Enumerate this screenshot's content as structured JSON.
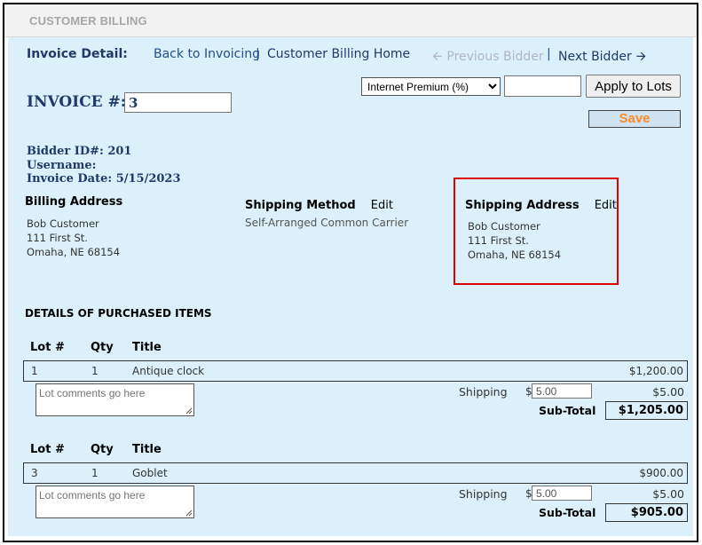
{
  "app": {
    "title": "CUSTOMER BILLING"
  },
  "nav": {
    "section_label": "Invoice Detail:",
    "back_link": "Back to Invoicing",
    "sep1": "|",
    "home_link": "Customer Billing Home",
    "prev_label": "Previous Bidder",
    "sep2": "|",
    "next_label": "Next Bidder"
  },
  "controls": {
    "premium_select": "Internet Premium (%)",
    "premium_value": "",
    "apply_label": "Apply to Lots",
    "save_label": "Save"
  },
  "invoice": {
    "number_label": "INVOICE #:",
    "number": "3",
    "bidder_id": "Bidder ID#: 201",
    "username": "Username:",
    "invoice_date": "Invoice Date: 5/15/2023"
  },
  "billing_address": {
    "heading": "Billing Address",
    "name": "Bob Customer",
    "street": "111 First St.",
    "city": "Omaha, NE 68154"
  },
  "shipping_method": {
    "heading": "Shipping Method",
    "edit_label": "Edit",
    "value": "Self-Arranged Common Carrier"
  },
  "shipping_address": {
    "heading": "Shipping Address",
    "edit_label": "Edit",
    "name": "Bob Customer",
    "street": "111 First St.",
    "city": "Omaha, NE 68154"
  },
  "details_heading": "DETAILS OF PURCHASED ITEMS",
  "items": [
    {
      "col_lot": "Lot #",
      "col_qty": "Qty",
      "col_title": "Title",
      "lot": "1",
      "qty": "1",
      "title": "Antique clock",
      "price": "$1,200.00",
      "comment_placeholder": "Lot comments go here",
      "shipping_label": "Shipping",
      "currency": "$",
      "shipping_input": "5.00",
      "shipping_amount": "$5.00",
      "subtotal_label": "Sub-Total",
      "subtotal": "$1,205.00"
    },
    {
      "col_lot": "Lot #",
      "col_qty": "Qty",
      "col_title": "Title",
      "lot": "3",
      "qty": "1",
      "title": "Goblet",
      "price": "$900.00",
      "comment_placeholder": "Lot comments go here",
      "shipping_label": "Shipping",
      "currency": "$",
      "shipping_input": "5.00",
      "shipping_amount": "$5.00",
      "subtotal_label": "Sub-Total",
      "subtotal": "$905.00"
    }
  ],
  "colors": {
    "panel_bg": "#dbf0fa",
    "navy_text": "#1f3a68",
    "link": "#1f4e8c",
    "save_text": "#ff8c2a",
    "highlight_box": "#e00000"
  }
}
